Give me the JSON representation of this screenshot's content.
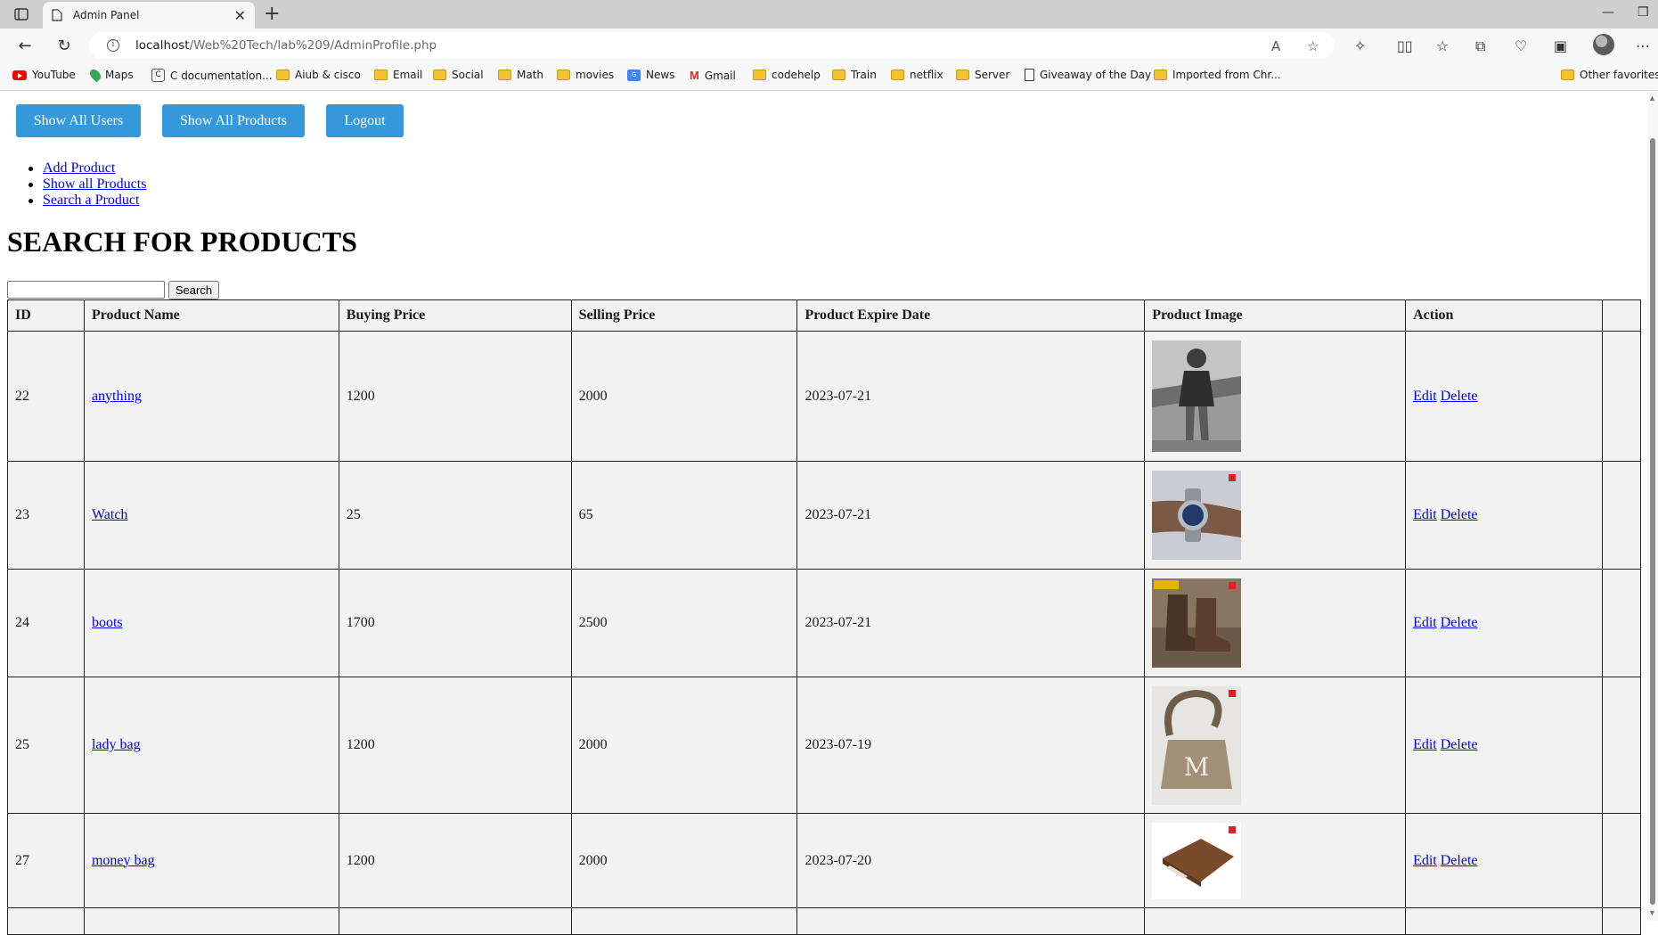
{
  "browser": {
    "tab_title": "Admin Panel",
    "url_host": "localhost",
    "url_path": "/Web%20Tech/lab%209/AdminProfile.php",
    "favorites": [
      {
        "label": "YouTube",
        "icon": "youtube-icon"
      },
      {
        "label": "Maps",
        "icon": "maps-icon"
      },
      {
        "label": "C documentation...",
        "icon": "c-doc-icon"
      },
      {
        "label": "Aiub & cisco",
        "icon": "folder-icon"
      },
      {
        "label": "Email",
        "icon": "folder-icon"
      },
      {
        "label": "Social",
        "icon": "folder-icon"
      },
      {
        "label": "Math",
        "icon": "folder-icon"
      },
      {
        "label": "movies",
        "icon": "folder-icon"
      },
      {
        "label": "News",
        "icon": "news-icon"
      },
      {
        "label": "Gmail",
        "icon": "gmail-icon"
      },
      {
        "label": "codehelp",
        "icon": "folder-icon"
      },
      {
        "label": "Train",
        "icon": "folder-icon"
      },
      {
        "label": "netflix",
        "icon": "folder-icon"
      },
      {
        "label": "Server",
        "icon": "folder-icon"
      },
      {
        "label": "Giveaway of the Day",
        "icon": "page-icon"
      },
      {
        "label": "Imported from Chr...",
        "icon": "folder-icon"
      },
      {
        "label": "Other favorites",
        "icon": "folder-icon"
      }
    ]
  },
  "header_buttons": {
    "show_users": "Show All Users",
    "show_products": "Show All Products",
    "logout": "Logout"
  },
  "menu": {
    "add_product": "Add Product",
    "show_all_products": "Show all Products",
    "search_product": "Search a Product"
  },
  "page_title": "SEARCH FOR PRODUCTS",
  "search": {
    "value": "",
    "button_label": "Search"
  },
  "table": {
    "headers": [
      "ID",
      "Product Name",
      "Buying Price",
      "Selling Price",
      "Product Expire Date",
      "Product Image",
      "Action"
    ],
    "edit_label": "Edit",
    "delete_label": "Delete",
    "rows": [
      {
        "id": "22",
        "name": "anything",
        "buying": "1200",
        "selling": "2000",
        "expire": "2023-07-21",
        "image": "man-photo"
      },
      {
        "id": "23",
        "name": "Watch",
        "buying": "25",
        "selling": "65",
        "expire": "2023-07-21",
        "image": "watch-photo"
      },
      {
        "id": "24",
        "name": "boots",
        "buying": "1700",
        "selling": "2500",
        "expire": "2023-07-21",
        "image": "boots-photo"
      },
      {
        "id": "25",
        "name": "lady bag",
        "buying": "1200",
        "selling": "2000",
        "expire": "2023-07-19",
        "image": "bag-photo"
      },
      {
        "id": "27",
        "name": "money bag",
        "buying": "1200",
        "selling": "2000",
        "expire": "2023-07-20",
        "image": "wallet-photo"
      }
    ]
  },
  "colors": {
    "button_bg": "#3598db",
    "table_bg": "#f2f2f2",
    "link": "#0000ee"
  }
}
